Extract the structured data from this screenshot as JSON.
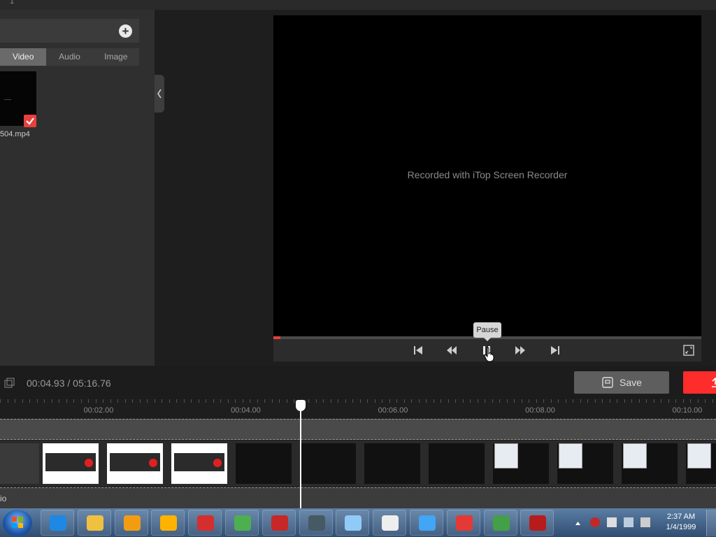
{
  "top": {
    "line_number": "1"
  },
  "media_panel": {
    "add_symbol": "+",
    "tabs": [
      {
        "label": "Video",
        "active": true
      },
      {
        "label": "Audio",
        "active": false
      },
      {
        "label": "Image",
        "active": false
      }
    ],
    "items": [
      {
        "filename": "504.mp4",
        "checked": true
      }
    ]
  },
  "preview": {
    "watermark": "Recorded with iTop Screen Recorder",
    "progress": 0.016,
    "tooltip": "Pause"
  },
  "toolbar": {
    "time_display": "00:04.93 / 05:16.76",
    "save_label": "Save"
  },
  "timeline": {
    "ticks": [
      "00:02.00",
      "00:04.00",
      "00:06.00",
      "00:08.00",
      "00:10.00"
    ],
    "audio_label": "io"
  },
  "taskbar": {
    "clock_time": "2:37 AM",
    "clock_date": "1/4/1999",
    "apps": [
      "internet-explorer-icon",
      "file-explorer-icon",
      "media-player-icon",
      "browser-shield-icon",
      "driver-booster-icon",
      "chrome-icon",
      "screen-recorder-icon",
      "app-grid-icon",
      "notepad-icon",
      "7zip-icon",
      "computer-monitor-icon",
      "avg-icon",
      "add-green-icon",
      "video-editor-icon"
    ]
  },
  "colors": {
    "accent": "#e8403c",
    "export": "#ff2c2c",
    "panel": "#2f2f2f"
  }
}
